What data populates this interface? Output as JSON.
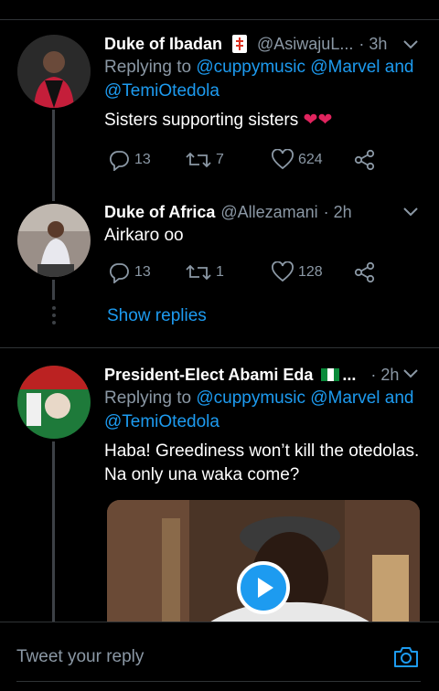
{
  "tweets": [
    {
      "name": "Duke of Ibadan",
      "handle": "@AsiwajuL...",
      "time": "· 3h",
      "replying_prefix": "Replying to",
      "mentions": "@cuppymusic @Marvel and",
      "mentions2": "@TemiOtedola",
      "text": "Sisters supporting sisters ❤❤",
      "replies": "13",
      "retweets": "7",
      "likes": "624"
    },
    {
      "name": "Duke of Africa",
      "handle": "@Allezamani",
      "time": "· 2h",
      "text": "Airkaro oo",
      "replies": "13",
      "retweets": "1",
      "likes": "128"
    },
    {
      "name": "President-Elect Abami Eda",
      "handle": "...",
      "time": "· 2h",
      "replying_prefix": "Replying to",
      "mentions": "@cuppymusic @Marvel and",
      "mentions2": "@TemiOtedola",
      "text_line1": "Haba! Greediness won’t kill the otedolas.",
      "text_line2": "Na only una waka come?"
    }
  ],
  "show_replies": "Show replies",
  "composer": {
    "placeholder": "Tweet your reply"
  },
  "colors": {
    "accent": "#1d9bf0",
    "muted": "#8b98a5",
    "background": "#000000"
  },
  "icons": [
    "reply-icon",
    "retweet-icon",
    "like-icon",
    "share-icon",
    "chevron-down-icon",
    "play-icon",
    "camera-icon",
    "flag-nigeria-icon",
    "mahjong-tile-icon"
  ]
}
